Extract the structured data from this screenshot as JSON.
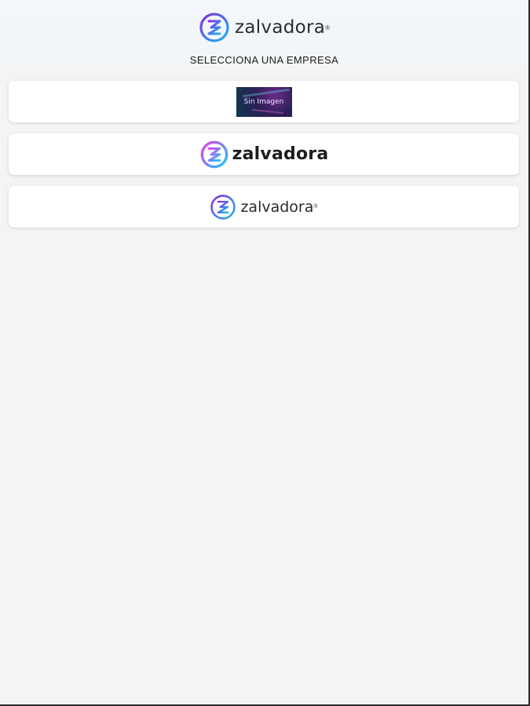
{
  "header": {
    "brand_name": "zalvadora",
    "registered_mark": "®",
    "subtitle": "SELECCIONA UNA EMPRESA"
  },
  "companies": [
    {
      "kind": "placeholder-image",
      "image_text": "Sin Imagen"
    },
    {
      "kind": "logo-bold",
      "logo_text": "zalvadora"
    },
    {
      "kind": "logo-light",
      "logo_text": "zalvadora",
      "registered_mark": "®"
    }
  ],
  "icons": {
    "brand": "zalvadora-z-logo-icon"
  },
  "colors": {
    "background": "#f4f4f4",
    "header_gradient_top": "#f1f7fb",
    "logo_gradient_start": "#8a2be2",
    "logo_gradient_end": "#16b7f0",
    "logo_bold_gradient_start": "#e43ef0",
    "logo_bold_gradient_end": "#1ec8f5"
  }
}
